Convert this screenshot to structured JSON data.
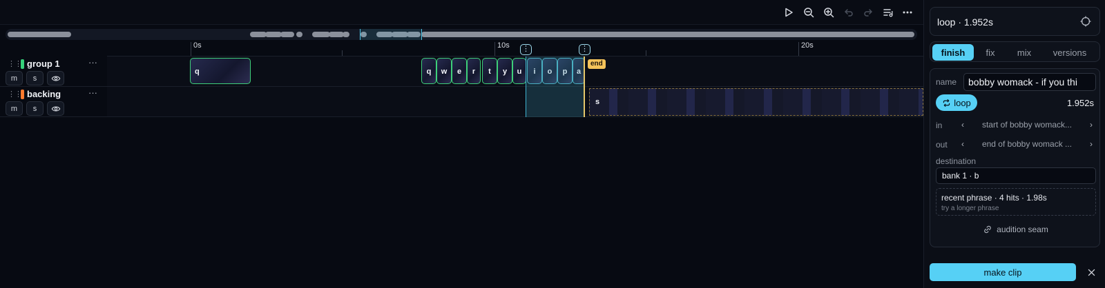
{
  "timeline": {
    "ruler": {
      "ticks": [
        "0s",
        "10s",
        "20s"
      ]
    },
    "loop_markers": [
      "⋮",
      "⋮"
    ],
    "end_badge": "end",
    "tracks": [
      {
        "name": "group 1",
        "color": "#36d17a",
        "buttons": {
          "mute": "m",
          "solo": "s"
        }
      },
      {
        "name": "backing",
        "color": "#ff7a2e",
        "buttons": {
          "mute": "m",
          "solo": "s"
        }
      }
    ],
    "clips_group1": [
      "q",
      "q",
      "w",
      "e",
      "r",
      "t",
      "y",
      "u",
      "i",
      "o",
      "p",
      "a"
    ],
    "clip_backing": "s"
  },
  "panel": {
    "title": "loop · 1.952s",
    "tabs": [
      "finish",
      "fix",
      "mix",
      "versions"
    ],
    "active_tab": "finish",
    "name_label": "name",
    "name_value": "bobby womack - if you thi",
    "loop_button": "loop",
    "loop_length": "1.952s",
    "in_label": "in",
    "in_value": "start of bobby womack...",
    "out_label": "out",
    "out_value": "end of bobby womack ...",
    "destination_label": "destination",
    "destination_value": "bank 1 · b",
    "phrase_title": "recent phrase · 4 hits · 1.98s",
    "phrase_hint": "try a longer phrase",
    "audition": "audition seam",
    "make_clip": "make clip"
  },
  "colors": {
    "accent": "#56d0f5",
    "clip_border": "#3ed07a",
    "end_marker": "#f4c35a"
  }
}
